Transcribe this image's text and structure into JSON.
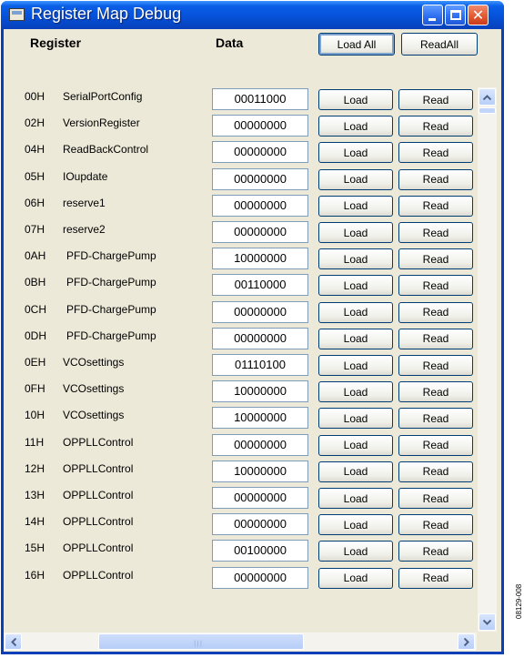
{
  "window": {
    "title": "Register Map Debug"
  },
  "header": {
    "register_label": "Register",
    "data_label": "Data",
    "load_all": "Load All",
    "read_all": "ReadAll"
  },
  "buttons": {
    "load": "Load",
    "read": "Read"
  },
  "rows": [
    {
      "addr": "00H",
      "name": "SerialPortConfig",
      "value": "00011000"
    },
    {
      "addr": "02H",
      "name": "VersionRegister",
      "value": "00000000"
    },
    {
      "addr": "04H",
      "name": "ReadBackControl",
      "value": "00000000"
    },
    {
      "addr": "05H",
      "name": "IOupdate",
      "value": "00000000"
    },
    {
      "addr": "06H",
      "name": "reserve1",
      "value": "00000000"
    },
    {
      "addr": "07H",
      "name": "reserve2",
      "value": "00000000"
    },
    {
      "addr": "0AH",
      "name": "PFD-ChargePump",
      "value": "10000000"
    },
    {
      "addr": "0BH",
      "name": "PFD-ChargePump",
      "value": "00110000"
    },
    {
      "addr": "0CH",
      "name": "PFD-ChargePump",
      "value": "00000000"
    },
    {
      "addr": "0DH",
      "name": "PFD-ChargePump",
      "value": "00000000"
    },
    {
      "addr": "0EH",
      "name": "VCOsettings",
      "value": "01110100"
    },
    {
      "addr": "0FH",
      "name": "VCOsettings",
      "value": "10000000"
    },
    {
      "addr": "10H",
      "name": "VCOsettings",
      "value": "10000000"
    },
    {
      "addr": "11H",
      "name": "OPPLLControl",
      "value": "00000000"
    },
    {
      "addr": "12H",
      "name": "OPPLLControl",
      "value": "10000000"
    },
    {
      "addr": "13H",
      "name": "OPPLLControl",
      "value": "00000000"
    },
    {
      "addr": "14H",
      "name": "OPPLLControl",
      "value": "00000000"
    },
    {
      "addr": "15H",
      "name": "OPPLLControl",
      "value": "00100000"
    },
    {
      "addr": "16H",
      "name": "OPPLLControl",
      "value": "00000000"
    }
  ],
  "figure_id": "08129-008"
}
